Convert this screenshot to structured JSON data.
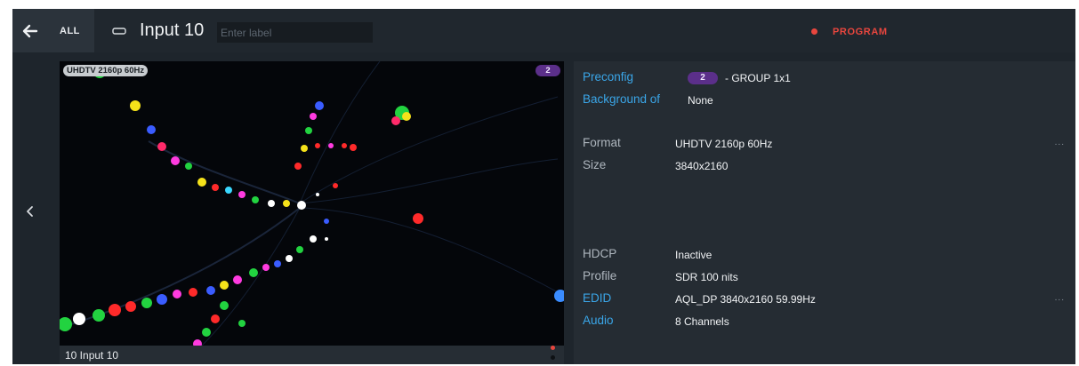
{
  "header": {
    "all_label": "ALL",
    "title": "Input 10",
    "label_placeholder": "Enter label",
    "status": "PROGRAM"
  },
  "preview": {
    "resolution_badge": "UHDTV 2160p 60Hz",
    "number_badge": "2",
    "caption": "10 Input 10"
  },
  "info": {
    "preconfig_label": "Preconfig",
    "preconfig_number": "2",
    "preconfig_value": "- GROUP 1x1",
    "background_label": "Background of",
    "background_value": "None",
    "format_label": "Format",
    "format_value": "UHDTV 2160p 60Hz",
    "size_label": "Size",
    "size_value": "3840x2160",
    "hdcp_label": "HDCP",
    "hdcp_value": "Inactive",
    "profile_label": "Profile",
    "profile_value": "SDR 100 nits",
    "edid_label": "EDID",
    "edid_value": "AQL_DP 3840x2160 59.99Hz",
    "audio_label": "Audio",
    "audio_value": "8 Channels",
    "more": "..."
  },
  "colors": {
    "accent_blue": "#3aa6e8",
    "program_red": "#e8463e",
    "badge_purple": "#5b2f8a"
  },
  "icons": [
    "back-arrow-icon",
    "input-port-icon",
    "record-dot-icon",
    "chevron-left-icon",
    "more-icon"
  ]
}
